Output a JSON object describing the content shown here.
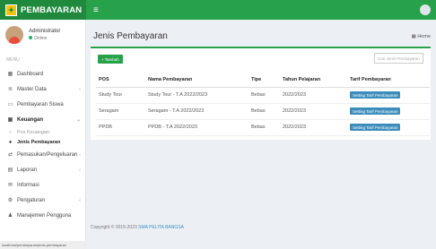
{
  "app": {
    "logo_text": "PEMBAYARAN"
  },
  "user": {
    "name": "Administrator",
    "status": "Online"
  },
  "sidebar": {
    "header": "MENU",
    "items": [
      {
        "label": "Dashboard",
        "icon": "dashboard-icon"
      },
      {
        "label": "Master Data",
        "icon": "database-icon"
      },
      {
        "label": "Pembayaran Siswa",
        "icon": "credit-card-icon"
      },
      {
        "label": "Keuangan",
        "icon": "money-icon"
      },
      {
        "label": "Pemasukan/Pengeluaran",
        "icon": "exchange-icon"
      },
      {
        "label": "Laporan",
        "icon": "file-icon"
      },
      {
        "label": "Informasi",
        "icon": "bell-icon"
      },
      {
        "label": "Pengaturan",
        "icon": "gear-icon"
      },
      {
        "label": "Manajemen Pengguna",
        "icon": "users-icon"
      }
    ],
    "submenu": [
      {
        "label": "Pos Keuangan"
      },
      {
        "label": "Jenis Pembayaran"
      }
    ]
  },
  "page": {
    "title": "Jenis Pembayaran",
    "breadcrumb": "Home"
  },
  "toolbar": {
    "add_label": "+ Tambah",
    "search_placeholder": "Cari Jenis Pembayaran"
  },
  "table": {
    "headers": [
      "POS",
      "Nama Pembayaran",
      "Tipe",
      "Tahun Pelajaran",
      "Tarif Pembayaran"
    ],
    "rows": [
      {
        "pos": "Study Tour",
        "nama": "Study Tour - T.A 2022/2023",
        "tipe": "Bebas",
        "tahun": "2022/2023",
        "action": "Setting Tarif Pembayaran"
      },
      {
        "pos": "Seragam",
        "nama": "Seragam - T.A 2022/2023",
        "tipe": "Bebas",
        "tahun": "2022/2023",
        "action": "Setting Tarif Pembayaran"
      },
      {
        "pos": "PPDB",
        "nama": "PPDB - T.A 2022/2023",
        "tipe": "Bebas",
        "tahun": "2022/2023",
        "action": "Setting Tarif Pembayaran"
      }
    ]
  },
  "footer": {
    "text": "Copyright © 2015-2023",
    "link": "SMA PELITA BANGSA"
  },
  "status_url": "localhost/pembayaran/jenis-pembayaran",
  "colors": {
    "brand_dark": "#1f8a3d",
    "brand": "#27a24a",
    "button_blue": "#3c8dbc"
  }
}
